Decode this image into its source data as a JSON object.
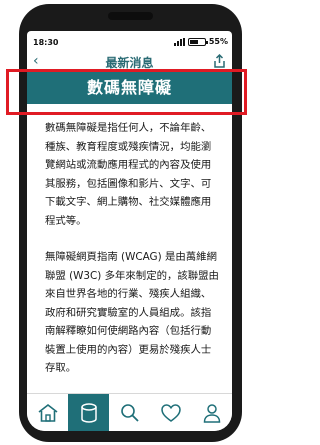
{
  "status": {
    "time": "18:30",
    "battery": "55%",
    "battery_level": 0.55
  },
  "nav": {
    "back_icon": "chevron-left-icon",
    "title": "最新消息",
    "share_icon": "share-icon"
  },
  "banner": {
    "title": "數碼無障礙"
  },
  "article": {
    "paragraphs": [
      "數碼無障礙是指任何人，不論年齡、種族、教育程度或殘疾情況，均能瀏覽網站或流動應用程式的內容及使用其服務，包括圖像和影片、文字、可下載文字、網上購物、社交媒體應用程式等。",
      "無障礙網頁指南 (WCAG) 是由萬維網聯盟 (W3C) 多年來制定的，該聯盟由來自世界各地的行業、殘疾人組織、政府和研究實驗室的人員組成。該指南解釋瞭如何使網路內容（包括行動裝置上使用的內容）更易於殘疾人士存取。"
    ]
  },
  "tabbar": {
    "active_color": "#1f6f78",
    "items": [
      {
        "icon": "home-icon"
      },
      {
        "icon": "database-icon"
      },
      {
        "icon": "search-icon"
      },
      {
        "icon": "heart-icon"
      },
      {
        "icon": "user-icon"
      }
    ]
  }
}
